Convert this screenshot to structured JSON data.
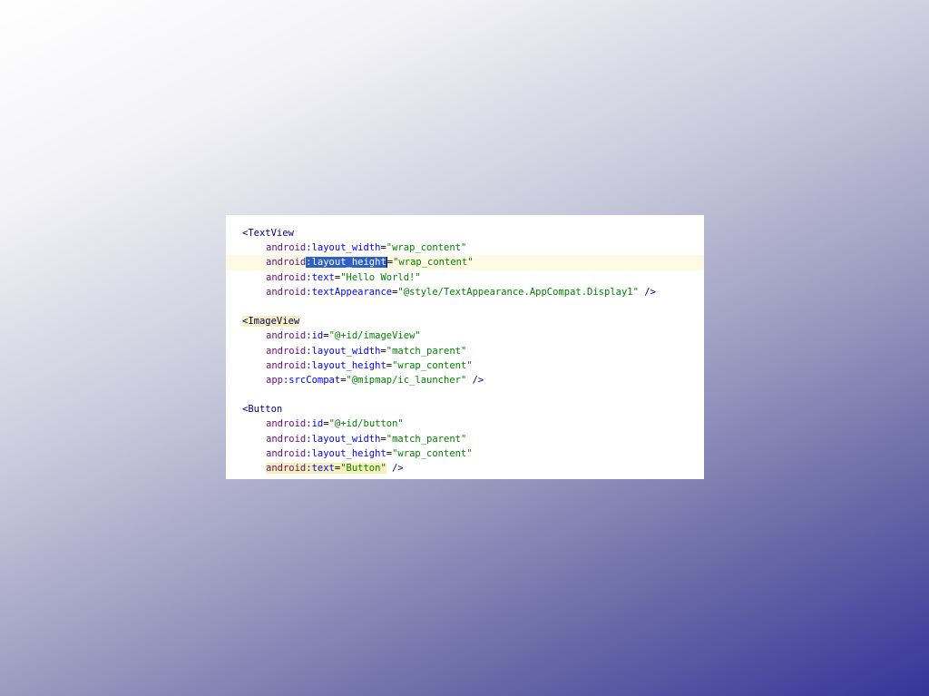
{
  "code_panel": {
    "lines": [
      {
        "type": "tag-open",
        "text": "<TextView"
      },
      {
        "type": "attr",
        "ns": "android",
        "name": "layout_width",
        "value": "\"wrap_content\"",
        "suffix": ""
      },
      {
        "type": "attr",
        "ns": "android",
        "name": "layout_height",
        "value": "\"wrap_content\"",
        "suffix": "",
        "current": true,
        "selected_name": true
      },
      {
        "type": "attr",
        "ns": "android",
        "name": "text",
        "value": "\"Hello World!\"",
        "suffix": ""
      },
      {
        "type": "attr",
        "ns": "android",
        "name": "textAppearance",
        "value": "\"@style/TextAppearance.AppCompat.Display1\"",
        "suffix": " />"
      },
      {
        "type": "blank"
      },
      {
        "type": "tag-open",
        "text": "<ImageView",
        "highlight_name": true
      },
      {
        "type": "attr",
        "ns": "android",
        "name": "id",
        "value": "\"@+id/imageView\"",
        "suffix": ""
      },
      {
        "type": "attr",
        "ns": "android",
        "name": "layout_width",
        "value": "\"match_parent\"",
        "suffix": ""
      },
      {
        "type": "attr",
        "ns": "android",
        "name": "layout_height",
        "value": "\"wrap_content\"",
        "suffix": ""
      },
      {
        "type": "attr",
        "ns": "app",
        "name": "srcCompat",
        "value": "\"@mipmap/ic_launcher\"",
        "suffix": " />"
      },
      {
        "type": "blank"
      },
      {
        "type": "tag-open",
        "text": "<Button"
      },
      {
        "type": "attr",
        "ns": "android",
        "name": "id",
        "value": "\"@+id/button\"",
        "suffix": ""
      },
      {
        "type": "attr",
        "ns": "android",
        "name": "layout_width",
        "value": "\"match_parent\"",
        "suffix": ""
      },
      {
        "type": "attr",
        "ns": "android",
        "name": "layout_height",
        "value": "\"wrap_content\"",
        "suffix": ""
      },
      {
        "type": "attr",
        "ns": "android",
        "name": "text",
        "value": "\"Button\"",
        "suffix": " />",
        "highlight_all": true
      }
    ]
  }
}
